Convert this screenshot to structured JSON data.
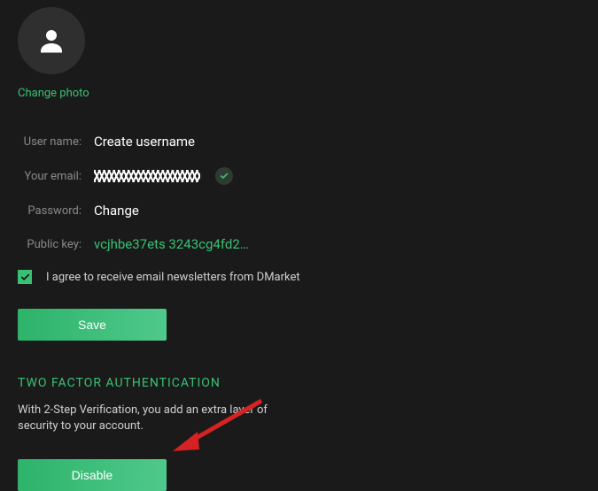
{
  "profile": {
    "change_photo_label": "Change photo",
    "fields": {
      "username_label": "User name:",
      "username_value": "Create username",
      "email_label": "Your email:",
      "password_label": "Password:",
      "password_value": "Change",
      "publickey_label": "Public key:",
      "publickey_value": "vcjhbe37ets 3243cg4fd2…"
    },
    "consent_text": "I agree to receive email newsletters from DMarket",
    "consent_checked": true,
    "save_button_label": "Save"
  },
  "twofa": {
    "title": "TWO FACTOR AUTHENTICATION",
    "description": "With 2-Step Verification, you add an extra layer of security to your account.",
    "button_label": "Disable"
  }
}
